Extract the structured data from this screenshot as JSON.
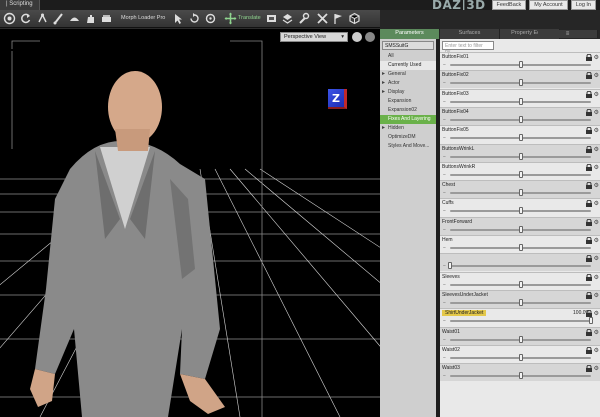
{
  "app": {
    "tab_label": "| Scripting",
    "brand": "DAZ|3D",
    "toplinks": [
      "FeedBack",
      "My Account",
      "Log In"
    ]
  },
  "toolbar": {
    "icons": [
      "target-icon",
      "refresh-icon",
      "universal-icon",
      "paint-icon",
      "hat-icon",
      "hand-icon",
      "sofa-icon",
      "pose-icon",
      "select-arrow-icon",
      "rotate-icon",
      "rotate-alt-icon",
      "scale-icon",
      "translate-icon",
      "node-icon",
      "stack-icon",
      "wrench-icon",
      "brush-icon",
      "flag-icon",
      "cube-icon"
    ],
    "morph_loader_label": "Morph Loader Pro",
    "translate_label": "Translate"
  },
  "viewport": {
    "view_label": "Perspective View",
    "gizmo_label": "Z"
  },
  "tabs": [
    "Parameters",
    "Surfaces",
    "Property Editor"
  ],
  "left_panel": {
    "selected_node": "SMSSuitG",
    "items": [
      {
        "label": "All",
        "kind": "sub"
      },
      {
        "label": "Currently Used",
        "kind": "hl"
      },
      {
        "label": "General",
        "kind": "cat"
      },
      {
        "label": "Actor",
        "kind": "cat"
      },
      {
        "label": "Display",
        "kind": "cat"
      },
      {
        "label": "Expansion",
        "kind": "sub"
      },
      {
        "label": "Expansion02",
        "kind": "sub"
      },
      {
        "label": "Fixes And Layering",
        "kind": "sel"
      },
      {
        "label": "Hidden",
        "kind": "cat"
      },
      {
        "label": "OptimizeDM",
        "kind": "sub"
      },
      {
        "label": "Styles And Move...",
        "kind": "sub"
      }
    ]
  },
  "params": {
    "filter_placeholder": "Enter text to filter by...",
    "rows": [
      {
        "name": "ButtonFix01",
        "value_frac": 0.5
      },
      {
        "name": "ButtonFix02",
        "value_frac": 0.5
      },
      {
        "name": "ButtonFix03",
        "value_frac": 0.5
      },
      {
        "name": "ButtonFix04",
        "value_frac": 0.5
      },
      {
        "name": "ButtonFix05",
        "value_frac": 0.5
      },
      {
        "name": "ButtonsWrinkL",
        "value_frac": 0.5
      },
      {
        "name": "ButtonsWrinkR",
        "value_frac": 0.5
      },
      {
        "name": "Chest",
        "value_frac": 0.5
      },
      {
        "name": "Cuffs",
        "value_frac": 0.5
      },
      {
        "name": "FrontForward",
        "value_frac": 0.5
      },
      {
        "name": "Hem",
        "value_frac": 0.5
      },
      {
        "name": "",
        "value_frac": 0.0
      },
      {
        "name": "Sleeves",
        "value_frac": 0.5
      },
      {
        "name": "SleevesUnderJacket",
        "value_frac": 0.5
      },
      {
        "name": "ShirtUnderJacket",
        "value_frac": 1.0,
        "value": "100.0%",
        "highlight": true
      },
      {
        "name": "Waist01",
        "value_frac": 0.5
      },
      {
        "name": "Waist02",
        "value_frac": 0.5
      },
      {
        "name": "Waist03",
        "value_frac": 0.5
      }
    ]
  }
}
